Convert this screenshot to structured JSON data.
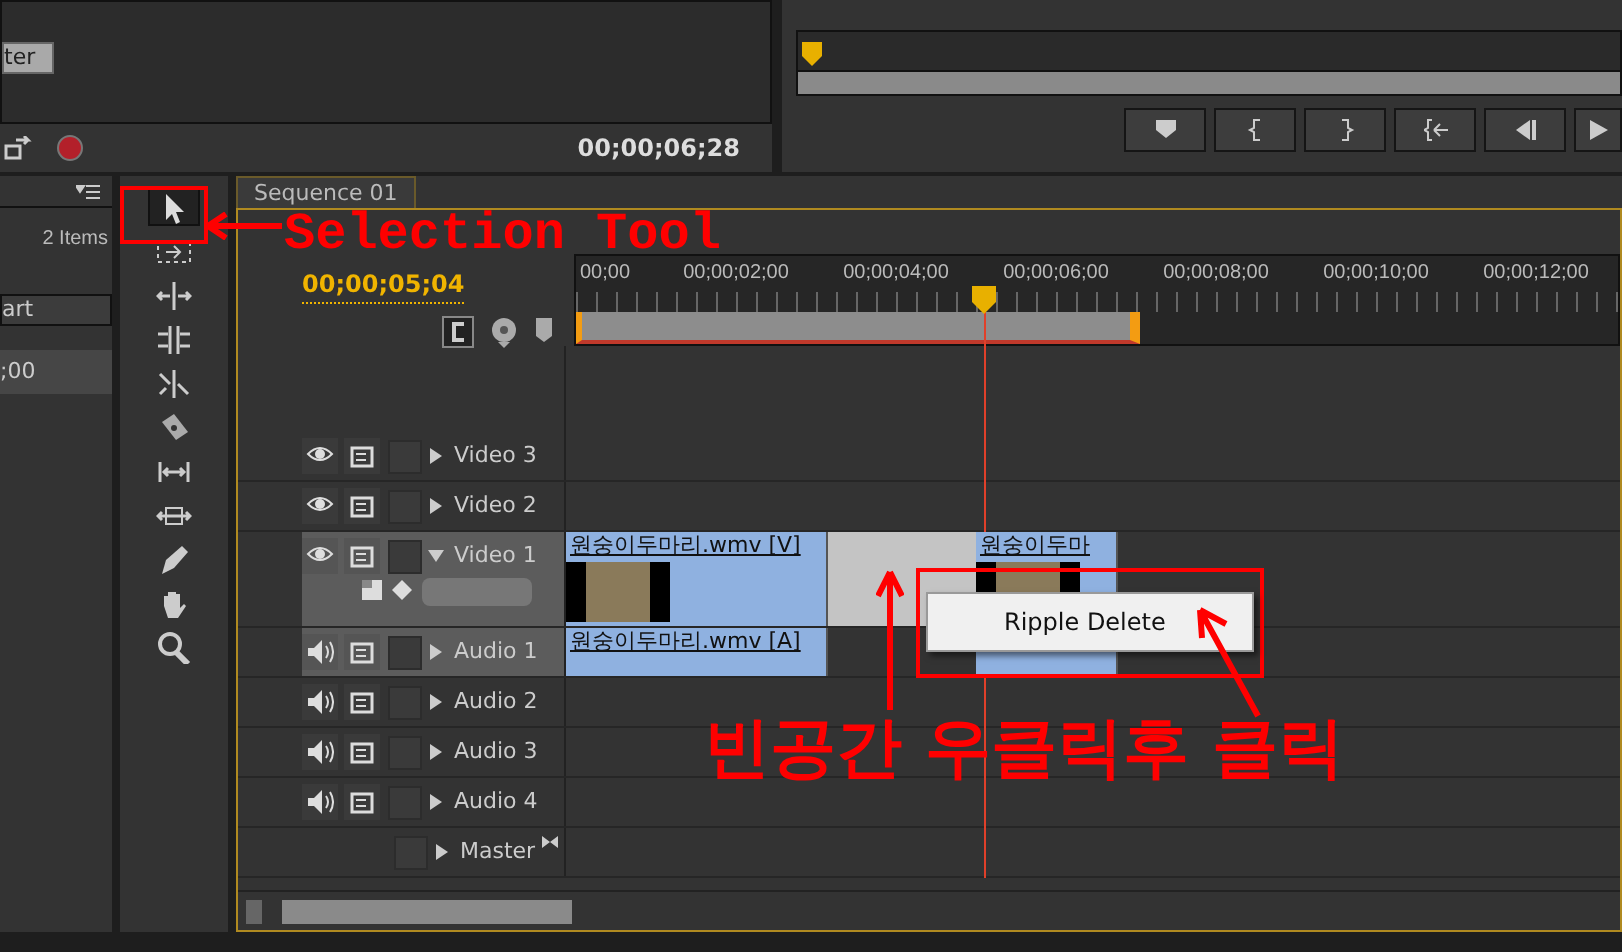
{
  "source_monitor": {
    "button_label": "ter",
    "timecode": "00;00;06;28"
  },
  "project_panel": {
    "item_count": "2 Items",
    "column_header": "art",
    "row_value": ";00"
  },
  "tools": [
    {
      "kind": "selection",
      "selected": true
    },
    {
      "kind": "track-select",
      "selected": false
    },
    {
      "kind": "ripple",
      "selected": false
    },
    {
      "kind": "rolling",
      "selected": false
    },
    {
      "kind": "rate",
      "selected": false
    },
    {
      "kind": "razor",
      "selected": false
    },
    {
      "kind": "slip",
      "selected": false
    },
    {
      "kind": "slide",
      "selected": false
    },
    {
      "kind": "pen",
      "selected": false
    },
    {
      "kind": "hand",
      "selected": false
    },
    {
      "kind": "zoom",
      "selected": false
    }
  ],
  "sequence": {
    "tab": "Sequence 01",
    "timecode": "00;00;05;04",
    "ruler_labels": [
      "00;00",
      "00;00;02;00",
      "00;00;04;00",
      "00;00;06;00",
      "00;00;08;00",
      "00;00;10;00",
      "00;00;12;00"
    ],
    "tracks": [
      {
        "name": "Video 3",
        "kind": "video",
        "expanded": false,
        "targeted": false
      },
      {
        "name": "Video 2",
        "kind": "video",
        "expanded": false,
        "targeted": false
      },
      {
        "name": "Video 1",
        "kind": "video",
        "expanded": true,
        "targeted": true,
        "clips": [
          {
            "kind": "clip",
            "label": "원숭이두마리.wmv [V]"
          },
          {
            "kind": "gap",
            "selected": true
          },
          {
            "kind": "clip",
            "label": "원숭이두마"
          }
        ]
      },
      {
        "name": "Audio 1",
        "kind": "audio",
        "expanded": false,
        "targeted": true,
        "clips": [
          {
            "kind": "clip",
            "label": "원숭이두마리.wmv [A]"
          },
          {
            "kind": "gap"
          },
          {
            "kind": "clip"
          }
        ]
      },
      {
        "name": "Audio 2",
        "kind": "audio",
        "expanded": false,
        "targeted": false
      },
      {
        "name": "Audio 3",
        "kind": "audio",
        "expanded": false,
        "targeted": false
      },
      {
        "name": "Audio 4",
        "kind": "audio",
        "expanded": false,
        "targeted": false
      },
      {
        "name": "Master",
        "kind": "master",
        "expanded": false,
        "targeted": false
      }
    ]
  },
  "context_menu": {
    "items": [
      {
        "label": "Ripple Delete"
      }
    ]
  },
  "annotations": [
    {
      "kind": "tool-label",
      "text": "Selection Tool"
    },
    {
      "kind": "instruction",
      "text": "빈공간 우클릭후 클릭"
    }
  ]
}
